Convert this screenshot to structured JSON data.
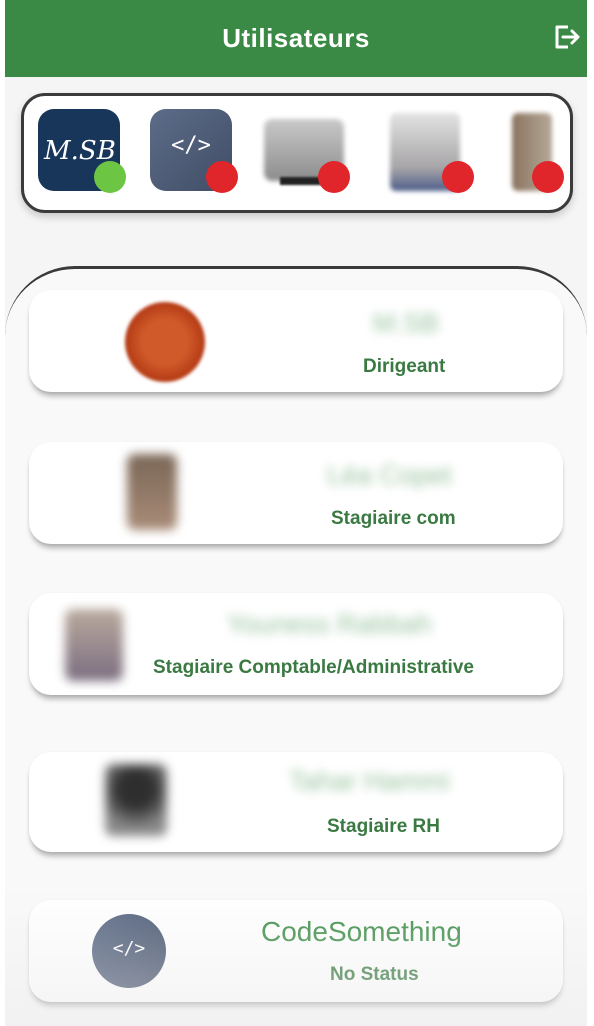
{
  "header": {
    "title": "Utilisateurs",
    "logout_icon": "logout-icon",
    "color": "#3a8a45"
  },
  "stories": [
    {
      "id": "msb",
      "avatar_text": "M.SB",
      "status": "online",
      "status_color": "#6cc644"
    },
    {
      "id": "codesomething",
      "avatar_text": "</>",
      "status": "offline",
      "status_color": "#e0262b"
    },
    {
      "id": "user-3",
      "status": "offline",
      "status_color": "#e0262b"
    },
    {
      "id": "user-4",
      "status": "offline",
      "status_color": "#e0262b"
    },
    {
      "id": "user-5",
      "status": "offline",
      "status_color": "#e0262b"
    }
  ],
  "users": [
    {
      "name": "M.SB",
      "role": "Dirigeant"
    },
    {
      "name": "Léa Copet",
      "role": "Stagiaire com"
    },
    {
      "name": "Youness Rabbah",
      "role": "Stagiaire Comptable/Administrative"
    },
    {
      "name": "Tahar Hammi",
      "role": "Stagiaire RH"
    },
    {
      "name": "CodeSomething",
      "role": "No Status",
      "avatar_text": "</>"
    }
  ],
  "colors": {
    "accent_green": "#3a8a45",
    "online": "#6cc644",
    "offline": "#e0262b",
    "code_avatar": "#4f5f7c"
  }
}
